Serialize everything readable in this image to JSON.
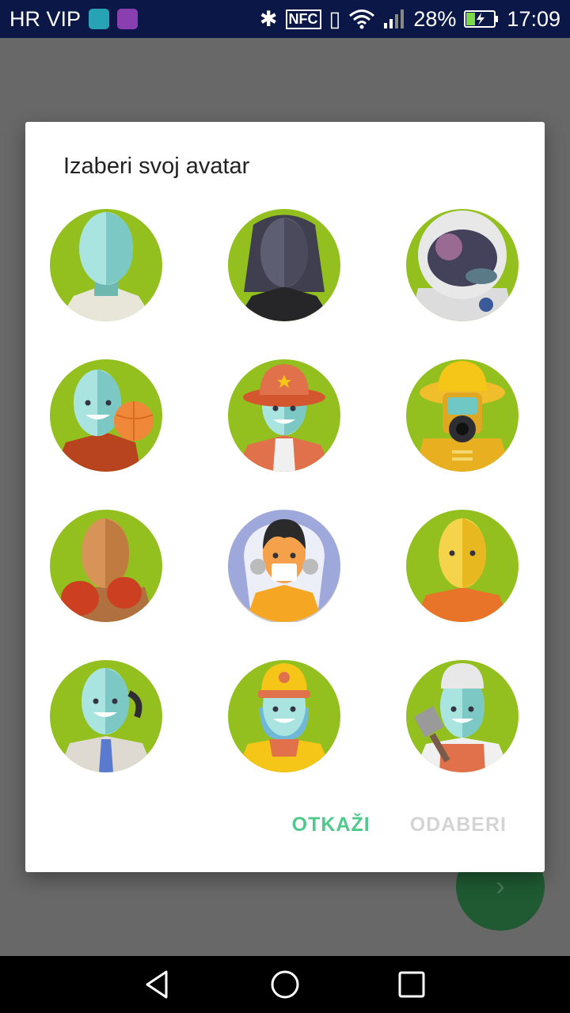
{
  "status_bar": {
    "carrier": "HR VIP",
    "nfc": "NFC",
    "battery": "28%",
    "time": "17:09"
  },
  "dialog": {
    "title": "Izaberi svoj avatar",
    "cancel_label": "OTKAŽI",
    "select_label": "ODABERI",
    "selected_index": 7,
    "avatars": [
      "avatar-1",
      "avatar-2",
      "avatar-3",
      "avatar-4",
      "avatar-5",
      "avatar-6",
      "avatar-7",
      "avatar-8",
      "avatar-9",
      "avatar-10",
      "avatar-11",
      "avatar-12"
    ]
  },
  "fab": {
    "icon": "chevron-right-icon"
  },
  "nav_bar": {
    "back": "back-icon",
    "home": "home-icon",
    "recents": "recents-icon"
  },
  "colors": {
    "avatar_bg": "#93c01f",
    "accent": "#4fc98c",
    "selected_bg": "#9fa8da"
  }
}
